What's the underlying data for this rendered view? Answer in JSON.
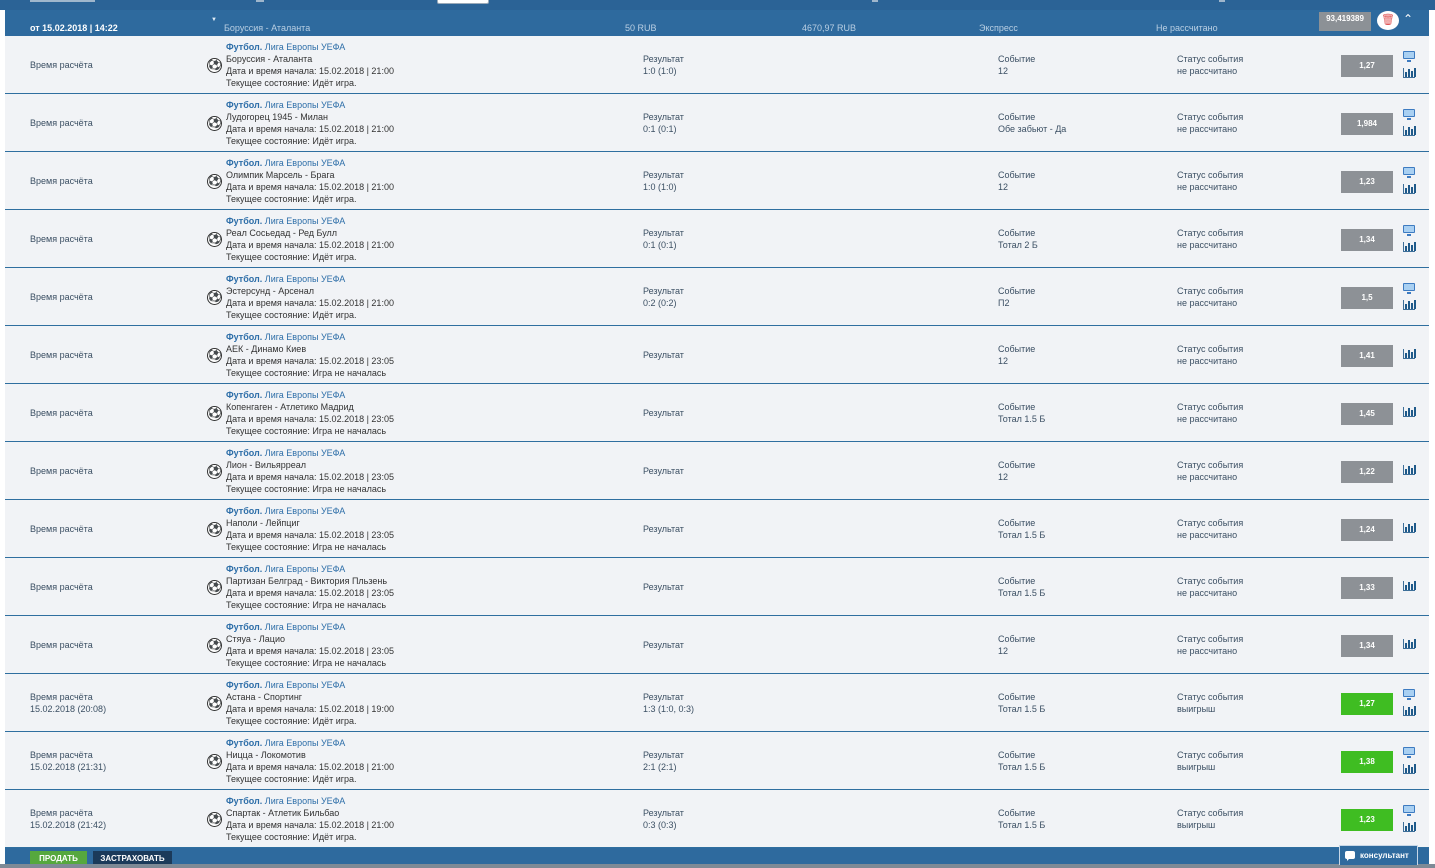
{
  "header": {
    "date": "от 15.02.2018 | 14:22",
    "teams": "Боруссия - Аталанта",
    "stake": "50 RUB",
    "payout": "4670,97 RUB",
    "type": "Экспресс",
    "status": "Не рассчитано",
    "total_odds": "93,419389"
  },
  "labels": {
    "time": "Время расчёта",
    "league": "Футбол.",
    "league_name": "Лига Европы УЕФА",
    "datetime": "Дата и время начала: ",
    "state": "Текущее состояние: ",
    "result": "Результат",
    "event": "Событие",
    "status": "Статус события"
  },
  "rows": [
    {
      "settled": "",
      "teams": "Боруссия - Аталанта",
      "start": "15.02.2018 | 21:00",
      "state": "Идёт игра.",
      "score": "1:0 (1:0)",
      "event": "12",
      "status": "не рассчитано",
      "odd": "1,27"
    },
    {
      "settled": "",
      "teams": "Лудогорец 1945 - Милан",
      "start": "15.02.2018 | 21:00",
      "state": "Идёт игра.",
      "score": "0:1 (0:1)",
      "event": "Обе забьют - Да",
      "status": "не рассчитано",
      "odd": "1,984"
    },
    {
      "settled": "",
      "teams": "Олимпик Марсель - Брага",
      "start": "15.02.2018 | 21:00",
      "state": "Идёт игра.",
      "score": "1:0 (1:0)",
      "event": "12",
      "status": "не рассчитано",
      "odd": "1,23"
    },
    {
      "settled": "",
      "teams": "Реал Сосьедад - Ред Булл",
      "start": "15.02.2018 | 21:00",
      "state": "Идёт игра.",
      "score": "0:1 (0:1)",
      "event": "Тотал 2 Б",
      "status": "не рассчитано",
      "odd": "1,34"
    },
    {
      "settled": "",
      "teams": "Эстерсунд - Арсенал",
      "start": "15.02.2018 | 21:00",
      "state": "Идёт игра.",
      "score": "0:2 (0:2)",
      "event": "П2",
      "status": "не рассчитано",
      "odd": "1,5"
    },
    {
      "settled": "",
      "teams": "АЕК - Динамо Киев",
      "start": "15.02.2018 | 23:05",
      "state": "Игра не началась",
      "score": "",
      "event": "12",
      "status": "не рассчитано",
      "odd": "1,41"
    },
    {
      "settled": "",
      "teams": "Копенгаген - Атлетико Мадрид",
      "start": "15.02.2018 | 23:05",
      "state": "Игра не началась",
      "score": "",
      "event": "Тотал 1.5 Б",
      "status": "не рассчитано",
      "odd": "1,45"
    },
    {
      "settled": "",
      "teams": "Лион - Вильярреал",
      "start": "15.02.2018 | 23:05",
      "state": "Игра не началась",
      "score": "",
      "event": "12",
      "status": "не рассчитано",
      "odd": "1,22"
    },
    {
      "settled": "",
      "teams": "Наполи - Лейпциг",
      "start": "15.02.2018 | 23:05",
      "state": "Игра не началась",
      "score": "",
      "event": "Тотал 1.5 Б",
      "status": "не рассчитано",
      "odd": "1,24"
    },
    {
      "settled": "",
      "teams": "Партизан Белград - Виктория Пльзень",
      "start": "15.02.2018 | 23:05",
      "state": "Игра не началась",
      "score": "",
      "event": "Тотал 1.5 Б",
      "status": "не рассчитано",
      "odd": "1,33"
    },
    {
      "settled": "",
      "teams": "Стяуа - Лацио",
      "start": "15.02.2018 | 23:05",
      "state": "Игра не началась",
      "score": "",
      "event": "12",
      "status": "не рассчитано",
      "odd": "1,34"
    },
    {
      "settled": "15.02.2018 (20:08)",
      "teams": "Астана - Спортинг",
      "start": "15.02.2018 | 19:00",
      "state": "Идёт игра.",
      "score": "1:3 (1:0, 0:3)",
      "event": "Тотал 1.5 Б",
      "status": "выигрыш",
      "odd": "1,27"
    },
    {
      "settled": "15.02.2018 (21:31)",
      "teams": "Ницца - Локомотив",
      "start": "15.02.2018 | 21:00",
      "state": "Идёт игра.",
      "score": "2:1 (2:1)",
      "event": "Тотал 1.5 Б",
      "status": "выигрыш",
      "odd": "1,38"
    },
    {
      "settled": "15.02.2018 (21:42)",
      "teams": "Спартак - Атлетик Бильбао",
      "start": "15.02.2018 | 21:00",
      "state": "Идёт игра.",
      "score": "0:3 (0:3)",
      "event": "Тотал 1.5 Б",
      "status": "выигрыш",
      "odd": "1,23"
    }
  ],
  "footer": {
    "sell": "ПРОДАТЬ",
    "insure": "ЗАСТРАХОВАТЬ",
    "consultant": "консультант"
  },
  "colors": {
    "header_bg": "#2e6a9e",
    "odd_pending": "#8d9196",
    "odd_won": "#3fbd22"
  }
}
